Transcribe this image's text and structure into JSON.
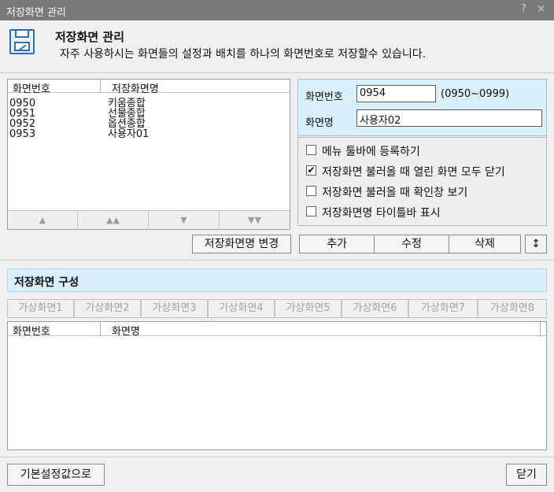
{
  "window": {
    "title": "저장화면 관리",
    "help": "?",
    "close": "×"
  },
  "header": {
    "title": "저장화면 관리",
    "description": "자주 사용하시는 화면들의 설정과 배치를 하나의 화면번호로 저장할수 있습니다."
  },
  "list": {
    "columns": [
      "화면번호",
      "저장화면명"
    ],
    "rows": [
      {
        "no": "0950",
        "name": "키움종합"
      },
      {
        "no": "0951",
        "name": "선물종합"
      },
      {
        "no": "0952",
        "name": "옵션종합"
      },
      {
        "no": "0953",
        "name": "사용자01"
      }
    ],
    "nav": [
      "▲",
      "▲▲",
      "▼",
      "▼▼"
    ]
  },
  "form": {
    "screen_no_label": "화면번호",
    "screen_no_value": "0954",
    "range_hint": "(0950~0999)",
    "screen_name_label": "화면명",
    "screen_name_value": "사용자02"
  },
  "options": [
    {
      "label": "메뉴 툴바에 등록하기",
      "checked": false
    },
    {
      "label": "저장화면 불러올 때 열린 화면 모두 닫기",
      "checked": true
    },
    {
      "label": "저장화면 불러올 때 확인창 보기",
      "checked": false
    },
    {
      "label": "저장화면명 타이틀바 표시",
      "checked": false
    }
  ],
  "buttons": {
    "rename": "저장화면명 변경",
    "add": "추가",
    "edit": "수정",
    "delete": "삭제",
    "reorder": "↕",
    "defaults": "기본설정값으로",
    "close": "닫기"
  },
  "composition": {
    "title": "저장화면 구성",
    "virtual_tabs": [
      "가상화면1",
      "가상화면2",
      "가상화면3",
      "가상화면4",
      "가상화면5",
      "가상화면6",
      "가상화면7",
      "가상화면8"
    ],
    "columns": [
      "화면번호",
      "화면명"
    ]
  },
  "colors": {
    "titlebar": "#7a7a7a",
    "panel_blue": "#d9eff9",
    "icon_blue": "#2c6fb5"
  }
}
